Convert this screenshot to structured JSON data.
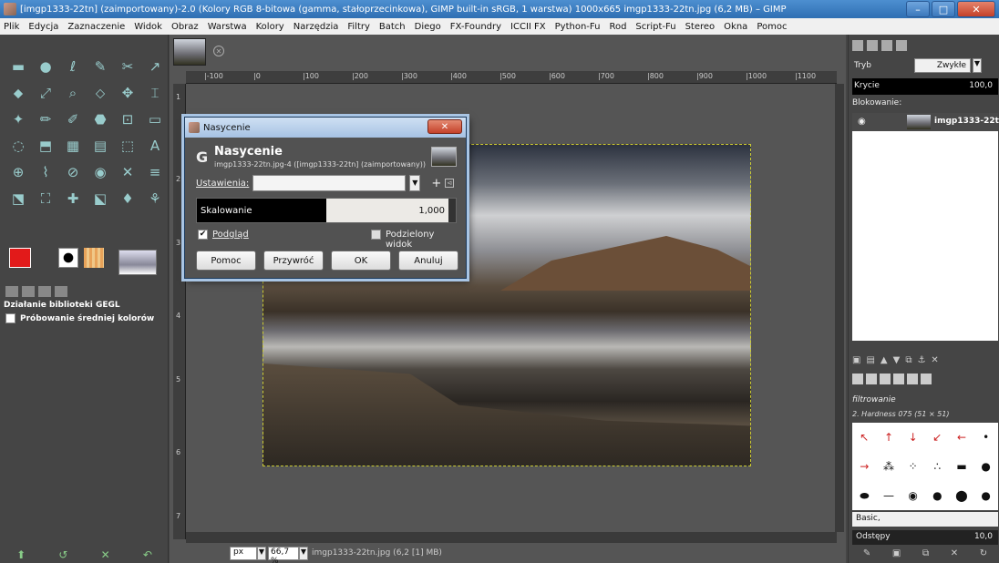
{
  "window": {
    "title": "[imgp1333-22tn] (zaimportowany)-2.0 (Kolory RGB 8-bitowa (gamma, stałoprzecinkowa), GIMP built-in sRGB, 1 warstwa) 1000x665 imgp1333-22tn.jpg (6,2 MB) – GIMP",
    "minimize": "–",
    "maximize": "□",
    "close": "✕"
  },
  "menu": [
    "Plik",
    "Edycja",
    "Zaznaczenie",
    "Widok",
    "Obraz",
    "Warstwa",
    "Kolory",
    "Narzędzia",
    "Filtry",
    "Batch",
    "Diego",
    "FX-Foundry",
    "ICCII FX",
    "Python-Fu",
    "Rod",
    "Script-Fu",
    "Stereo",
    "Okna",
    "Pomoc"
  ],
  "toolbox": {
    "tools": [
      "▬",
      "●",
      "ℓ",
      "✎",
      "✂",
      "↗",
      "⬥",
      "⤢",
      "⌕",
      "⬦",
      "✥",
      "⌶",
      "✦",
      "✏",
      "✐",
      "⬣",
      "⊡",
      "▭",
      "◌",
      "⬒",
      "▦",
      "▤",
      "⬚",
      "A",
      "⊕",
      "⌇",
      "⊘",
      "◉",
      "✕",
      "≡",
      "⬔",
      "⛶",
      "✚",
      "⬕",
      "♦",
      "⚘"
    ],
    "options_title": "Działanie biblioteki GEGL",
    "option_checkbox_label": "Próbowanie średniej kolorów",
    "colors": {
      "foreground": "#e21a1a",
      "background": "#ffffff"
    }
  },
  "canvas": {
    "ruler_labels": [
      "|-100",
      "|0",
      "|100",
      "|200",
      "|300",
      "|400",
      "|500",
      "|600",
      "|700",
      "|800",
      "|900",
      "|1000",
      "|1100"
    ],
    "vruler_labels": [
      "1",
      "2",
      "3",
      "4",
      "5",
      "6",
      "7"
    ],
    "status": {
      "unit": "px",
      "zoom": "66,7 %",
      "file_info": "imgp1333-22tn.jpg (6,2 [1] MB)"
    }
  },
  "dialog": {
    "window_title": "Nasycenie",
    "close_label": "✕",
    "heading": "Nasycenie",
    "subheading": "imgp1333-22tn.jpg-4 ([imgp1333-22tn] (zaimportowany))",
    "presets_label": "Ustawienia:",
    "presets_value": "",
    "scale_label": "Skalowanie",
    "scale_value": "1,000",
    "scale_fraction": 0.5,
    "preview_label": "Podgląd",
    "preview_checked": "✔",
    "split_label": "Podzielony widok",
    "buttons": {
      "help": "Pomoc",
      "reset": "Przywróć",
      "ok": "OK",
      "cancel": "Anuluj"
    }
  },
  "dock": {
    "mode_label": "Tryb",
    "mode_value": "Zwykłe",
    "opacity_label": "Krycie",
    "opacity_value": "100,0",
    "lock_label": "Blokowanie:",
    "layer_name": "imgp1333-22tn.",
    "filter_label": "filtrowanie",
    "brush_name": "2. Hardness 075 (51 × 51)",
    "brush_set": "Basic,",
    "spacing_label": "Odstępy",
    "spacing_value": "10,0"
  }
}
